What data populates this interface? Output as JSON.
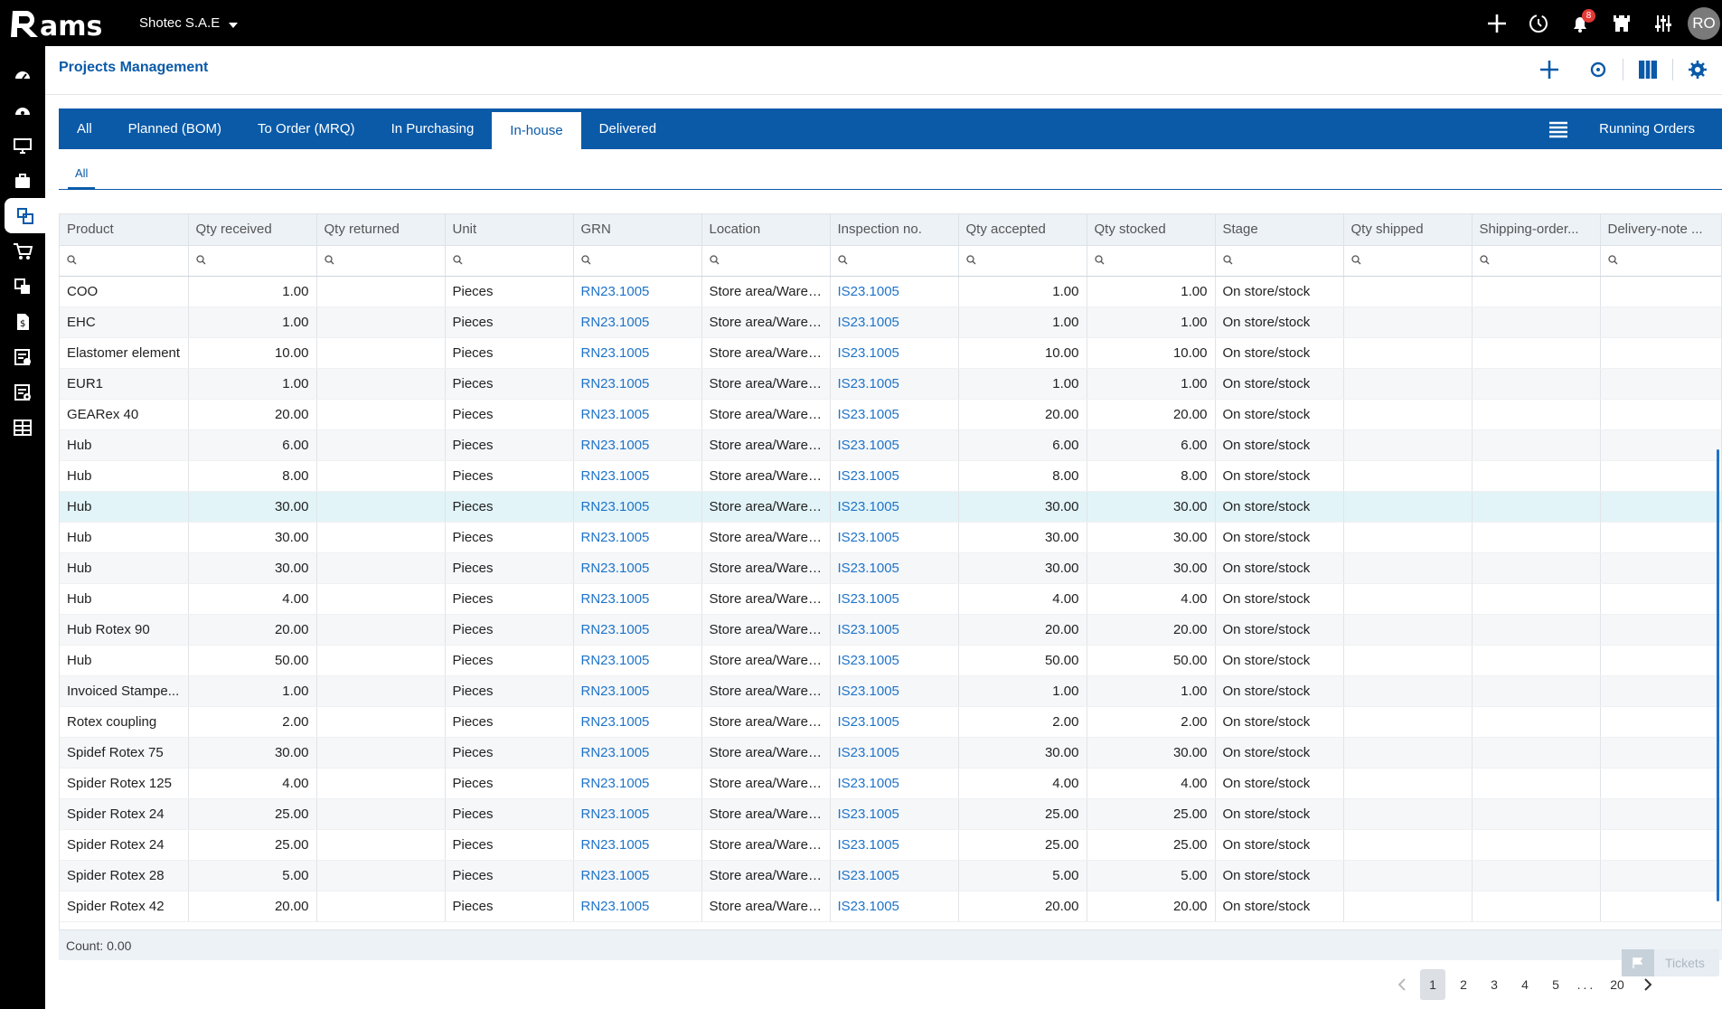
{
  "topbar": {
    "logo_text": "Rams",
    "company": "Shotec S.A.E",
    "notification_count": "8",
    "avatar": "RO",
    "icons": [
      "plus-icon",
      "history-icon",
      "bell-icon",
      "castle-icon",
      "sliders-icon"
    ]
  },
  "sidebar": {
    "icons": [
      "dashboard-icon",
      "speed-icon",
      "monitor-icon",
      "briefcase-icon",
      "projects-icon",
      "cart-icon",
      "swap-icon",
      "invoice-icon",
      "checklist-icon",
      "doc-settings-icon",
      "layout-icon"
    ],
    "active_index": 4
  },
  "header": {
    "title": "Projects Management",
    "tools": [
      "add-icon",
      "refresh-icon",
      "columns-icon",
      "settings-icon"
    ]
  },
  "tabs": [
    {
      "label": "All"
    },
    {
      "label": "Planned (BOM)"
    },
    {
      "label": "To Order (MRQ)"
    },
    {
      "label": "In Purchasing"
    },
    {
      "label": "In-house",
      "active": true
    },
    {
      "label": "Delivered"
    }
  ],
  "running_orders": "Running Orders",
  "subtab": "All",
  "grid": {
    "columns": [
      "Product",
      "Qty received",
      "Qty returned",
      "Unit",
      "GRN",
      "Location",
      "Inspection no.",
      "Qty accepted",
      "Qty stocked",
      "Stage",
      "Qty shipped",
      "Shipping-order...",
      "Delivery-note ..."
    ],
    "rows": [
      [
        "COO",
        "1.00",
        "",
        "Pieces",
        "RN23.1005",
        "Store area/Wareh...",
        "IS23.1005",
        "1.00",
        "1.00",
        "On store/stock",
        "",
        "",
        ""
      ],
      [
        "EHC",
        "1.00",
        "",
        "Pieces",
        "RN23.1005",
        "Store area/Wareh...",
        "IS23.1005",
        "1.00",
        "1.00",
        "On store/stock",
        "",
        "",
        ""
      ],
      [
        "Elastomer element",
        "10.00",
        "",
        "Pieces",
        "RN23.1005",
        "Store area/Wareh...",
        "IS23.1005",
        "10.00",
        "10.00",
        "On store/stock",
        "",
        "",
        ""
      ],
      [
        "EUR1",
        "1.00",
        "",
        "Pieces",
        "RN23.1005",
        "Store area/Wareh...",
        "IS23.1005",
        "1.00",
        "1.00",
        "On store/stock",
        "",
        "",
        ""
      ],
      [
        "GEARex 40",
        "20.00",
        "",
        "Pieces",
        "RN23.1005",
        "Store area/Wareh...",
        "IS23.1005",
        "20.00",
        "20.00",
        "On store/stock",
        "",
        "",
        ""
      ],
      [
        "Hub",
        "6.00",
        "",
        "Pieces",
        "RN23.1005",
        "Store area/Wareh...",
        "IS23.1005",
        "6.00",
        "6.00",
        "On store/stock",
        "",
        "",
        ""
      ],
      [
        "Hub",
        "8.00",
        "",
        "Pieces",
        "RN23.1005",
        "Store area/Wareh...",
        "IS23.1005",
        "8.00",
        "8.00",
        "On store/stock",
        "",
        "",
        ""
      ],
      [
        "Hub",
        "30.00",
        "",
        "Pieces",
        "RN23.1005",
        "Store area/Wareh...",
        "IS23.1005",
        "30.00",
        "30.00",
        "On store/stock",
        "",
        "",
        ""
      ],
      [
        "Hub",
        "30.00",
        "",
        "Pieces",
        "RN23.1005",
        "Store area/Wareh...",
        "IS23.1005",
        "30.00",
        "30.00",
        "On store/stock",
        "",
        "",
        ""
      ],
      [
        "Hub",
        "30.00",
        "",
        "Pieces",
        "RN23.1005",
        "Store area/Wareh...",
        "IS23.1005",
        "30.00",
        "30.00",
        "On store/stock",
        "",
        "",
        ""
      ],
      [
        "Hub",
        "4.00",
        "",
        "Pieces",
        "RN23.1005",
        "Store area/Wareh...",
        "IS23.1005",
        "4.00",
        "4.00",
        "On store/stock",
        "",
        "",
        ""
      ],
      [
        "Hub Rotex 90",
        "20.00",
        "",
        "Pieces",
        "RN23.1005",
        "Store area/Wareh...",
        "IS23.1005",
        "20.00",
        "20.00",
        "On store/stock",
        "",
        "",
        ""
      ],
      [
        "Hub",
        "50.00",
        "",
        "Pieces",
        "RN23.1005",
        "Store area/Wareh...",
        "IS23.1005",
        "50.00",
        "50.00",
        "On store/stock",
        "",
        "",
        ""
      ],
      [
        "Invoiced Stampe...",
        "1.00",
        "",
        "Pieces",
        "RN23.1005",
        "Store area/Wareh...",
        "IS23.1005",
        "1.00",
        "1.00",
        "On store/stock",
        "",
        "",
        ""
      ],
      [
        "Rotex coupling",
        "2.00",
        "",
        "Pieces",
        "RN23.1005",
        "Store area/Wareh...",
        "IS23.1005",
        "2.00",
        "2.00",
        "On store/stock",
        "",
        "",
        ""
      ],
      [
        "Spidef Rotex 75",
        "30.00",
        "",
        "Pieces",
        "RN23.1005",
        "Store area/Wareh...",
        "IS23.1005",
        "30.00",
        "30.00",
        "On store/stock",
        "",
        "",
        ""
      ],
      [
        "Spider Rotex 125",
        "4.00",
        "",
        "Pieces",
        "RN23.1005",
        "Store area/Wareh...",
        "IS23.1005",
        "4.00",
        "4.00",
        "On store/stock",
        "",
        "",
        ""
      ],
      [
        "Spider Rotex 24",
        "25.00",
        "",
        "Pieces",
        "RN23.1005",
        "Store area/Wareh...",
        "IS23.1005",
        "25.00",
        "25.00",
        "On store/stock",
        "",
        "",
        ""
      ],
      [
        "Spider Rotex 24",
        "25.00",
        "",
        "Pieces",
        "RN23.1005",
        "Store area/Wareh...",
        "IS23.1005",
        "25.00",
        "25.00",
        "On store/stock",
        "",
        "",
        ""
      ],
      [
        "Spider Rotex 28",
        "5.00",
        "",
        "Pieces",
        "RN23.1005",
        "Store area/Wareh...",
        "IS23.1005",
        "5.00",
        "5.00",
        "On store/stock",
        "",
        "",
        ""
      ],
      [
        "Spider Rotex 42",
        "20.00",
        "",
        "Pieces",
        "RN23.1005",
        "Store area/Wareh...",
        "IS23.1005",
        "20.00",
        "20.00",
        "On store/stock",
        "",
        "",
        ""
      ]
    ],
    "highlight_row": 7,
    "count_label": "Count: 0.00"
  },
  "tickets": "Tickets",
  "pagination": {
    "pages": [
      "1",
      "2",
      "3",
      "4",
      "5",
      "...",
      "20"
    ],
    "current": "1"
  },
  "colors": {
    "brand": "#0a5aa8",
    "link": "#1e73c8",
    "highlight": "#e2f4f8",
    "badge": "#e53935"
  }
}
